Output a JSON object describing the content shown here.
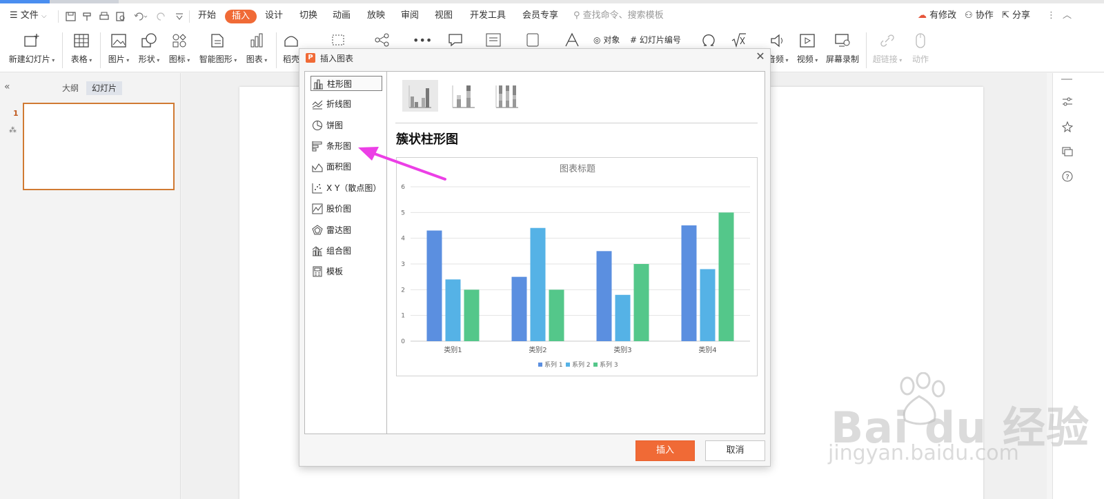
{
  "menu": {
    "file": "文件",
    "tabs": [
      "开始",
      "插入",
      "设计",
      "切换",
      "动画",
      "放映",
      "审阅",
      "视图",
      "开发工具",
      "会员专享"
    ],
    "search_placeholder": "查找命令、搜索模板",
    "right": [
      "有修改",
      "协作",
      "分享"
    ]
  },
  "ribbon": {
    "new_slide": "新建幻灯片",
    "table": "表格",
    "picture": "图片",
    "shape": "形状",
    "icon": "图标",
    "smartart": "智能图形",
    "chart": "图表",
    "daoke": "稻壳",
    "object": "对象",
    "slide_number": "幻灯片编号",
    "audio": "音频",
    "video": "视频",
    "screen_record": "屏幕录制",
    "hyperlink": "超链接",
    "action": "动作"
  },
  "left_panel": {
    "tab_outline": "大纲",
    "tab_slides": "幻灯片",
    "slide_number": "1"
  },
  "dialog": {
    "title": "插入图表",
    "types": [
      "柱形图",
      "折线图",
      "饼图",
      "条形图",
      "面积图",
      "X Y（散点图）",
      "股价图",
      "雷达图",
      "组合图",
      "模板"
    ],
    "selected_type": "柱形图",
    "subtype_name": "簇状柱形图",
    "insert_button": "插入",
    "cancel_button": "取消"
  },
  "chart_data": {
    "type": "bar",
    "title": "图表标题",
    "categories": [
      "类别1",
      "类别2",
      "类别3",
      "类别4"
    ],
    "series": [
      {
        "name": "系列 1",
        "values": [
          4.3,
          2.5,
          3.5,
          4.5
        ],
        "color": "#5b8fe0"
      },
      {
        "name": "系列 2",
        "values": [
          2.4,
          4.4,
          1.8,
          2.8
        ],
        "color": "#55b2e6"
      },
      {
        "name": "系列 3",
        "values": [
          2.0,
          2.0,
          3.0,
          5.0
        ],
        "color": "#54c78a"
      }
    ],
    "ylim": [
      0,
      6
    ],
    "yticks": [
      "0",
      "1",
      "2",
      "3",
      "4",
      "5",
      "6"
    ],
    "legend": "bottom",
    "grid": true
  },
  "watermark": {
    "brand": "Bai du 经验",
    "url": "jingyan.baidu.com"
  }
}
